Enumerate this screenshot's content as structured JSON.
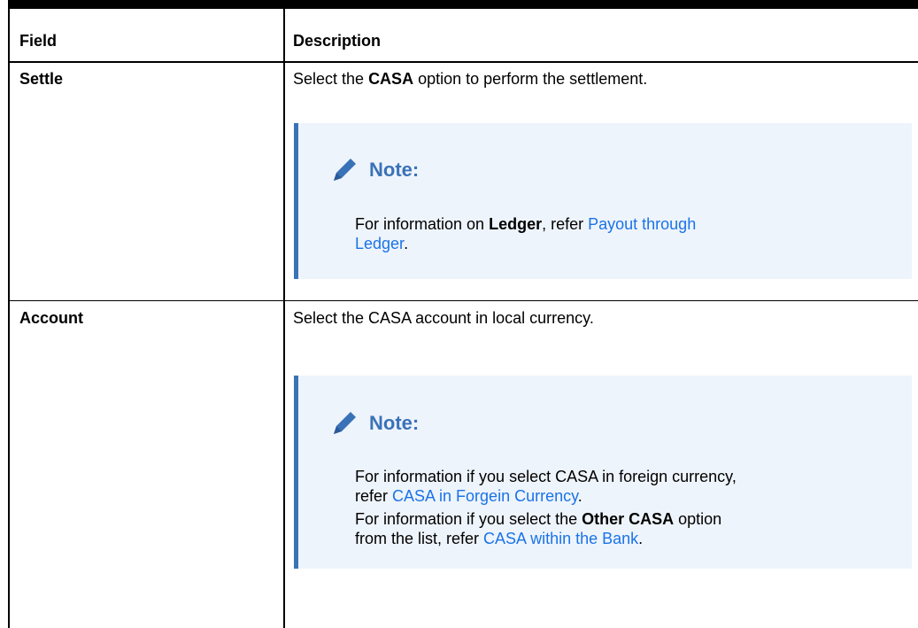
{
  "table": {
    "header": {
      "field": "Field",
      "description": "Description"
    },
    "rows": [
      {
        "field": "Settle",
        "desc_pre": "Select the ",
        "desc_bold": "CASA",
        "desc_post": " option to perform the settlement.",
        "note": {
          "title": "Note:",
          "pre": "For information on ",
          "bold": "Ledger",
          "mid": ", refer ",
          "link_line1": "Payout through",
          "link_line2": "Ledger",
          "post": "."
        }
      },
      {
        "field": "Account",
        "desc": "Select the CASA account in local currency.",
        "note": {
          "title": "Note:",
          "p1_line1": "For information if you select CASA in foreign currency,",
          "p1_pre": "refer ",
          "p1_link": "CASA in Forgein Currency",
          "p1_post": ".",
          "p2_pre": "For information if you select the ",
          "p2_bold": "Other CASA",
          "p2_post": " option",
          "p2_line2_pre": "from the list, refer ",
          "p2_link": "CASA within the Bank",
          "p2_post2": "."
        }
      }
    ]
  },
  "colors": {
    "note_accent": "#3a72b8",
    "note_bg": "#eef4fb",
    "link": "#1a73e8"
  },
  "icons": {
    "note": "pencil-icon"
  }
}
